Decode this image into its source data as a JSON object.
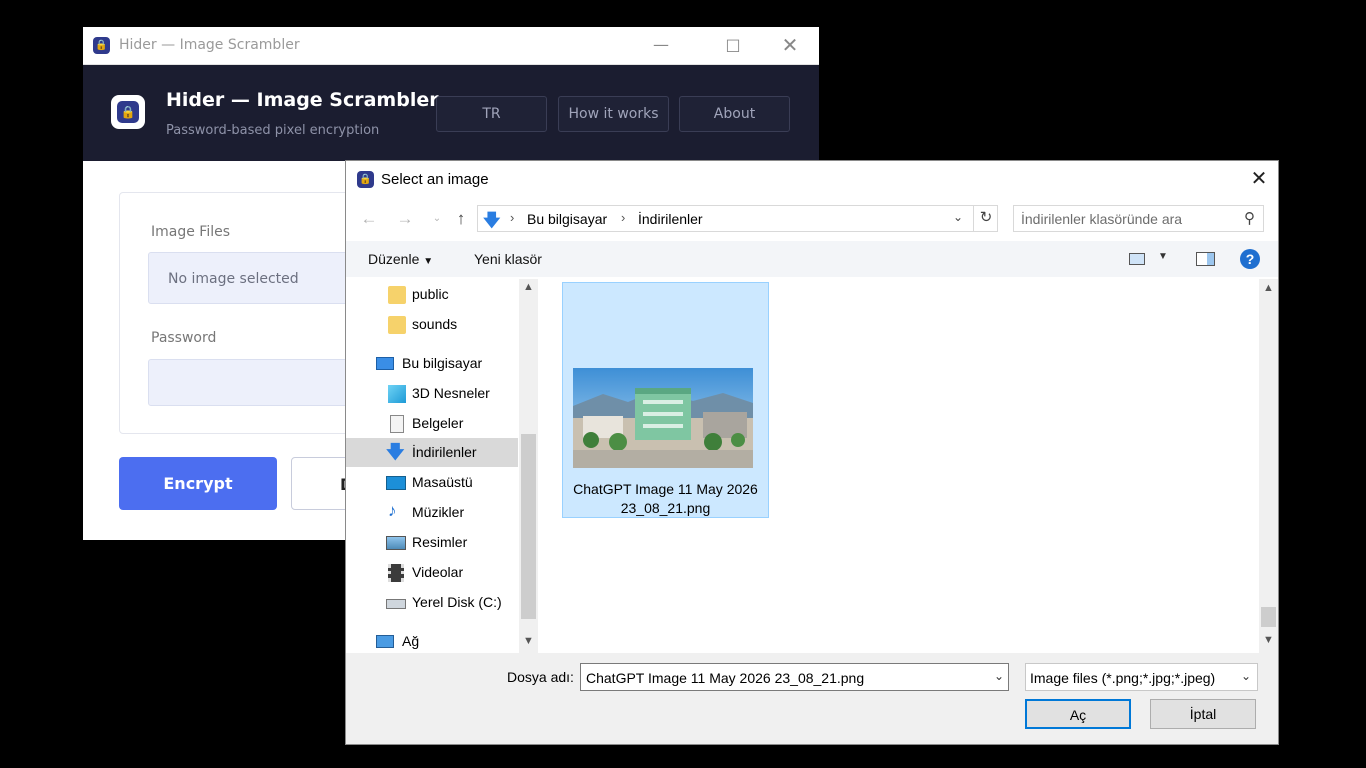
{
  "app": {
    "window_title": "Hider — Image Scrambler",
    "header_title": "Hider — Image Scrambler",
    "header_subtitle": "Password-based pixel encryption",
    "nav_buttons": [
      "TR",
      "How it works",
      "About"
    ],
    "image_files_label": "Image Files",
    "image_files_placeholder": "No image selected",
    "password_label": "Password",
    "encrypt_label": "Encrypt",
    "decrypt_label_visible": "D"
  },
  "dialog": {
    "title": "Select an image",
    "breadcrumb": [
      "Bu bilgisayar",
      "İndirilenler"
    ],
    "search_placeholder": "İndirilenler klasöründe ara",
    "toolbar": {
      "organize": "Düzenle",
      "new_folder": "Yeni klasör"
    },
    "nav_items": [
      {
        "label": "public",
        "icon": "folder-icon"
      },
      {
        "label": "sounds",
        "icon": "folder-icon"
      },
      {
        "label": "Bu bilgisayar",
        "icon": "computer-icon"
      },
      {
        "label": "3D Nesneler",
        "icon": "cube-icon"
      },
      {
        "label": "Belgeler",
        "icon": "document-icon"
      },
      {
        "label": "İndirilenler",
        "icon": "download-icon",
        "selected": true
      },
      {
        "label": "Masaüstü",
        "icon": "desktop-icon"
      },
      {
        "label": "Müzikler",
        "icon": "music-icon"
      },
      {
        "label": "Resimler",
        "icon": "pictures-icon"
      },
      {
        "label": "Videolar",
        "icon": "video-icon"
      },
      {
        "label": "Yerel Disk (C:)",
        "icon": "drive-icon"
      },
      {
        "label": "Ağ",
        "icon": "network-icon"
      }
    ],
    "file": {
      "name_line1": "ChatGPT Image 11 May 2026",
      "name_line2": "23_08_21.png"
    },
    "filename_label": "Dosya adı:",
    "filename_value": "ChatGPT Image 11 May 2026 23_08_21.png",
    "filetype_value": "Image files (*.png;*.jpg;*.jpeg)",
    "open_label": "Aç",
    "cancel_label": "İptal"
  },
  "colors": {
    "accent": "#4c6ef0",
    "header_bg": "#1b1d30",
    "selection": "#cce8ff"
  }
}
